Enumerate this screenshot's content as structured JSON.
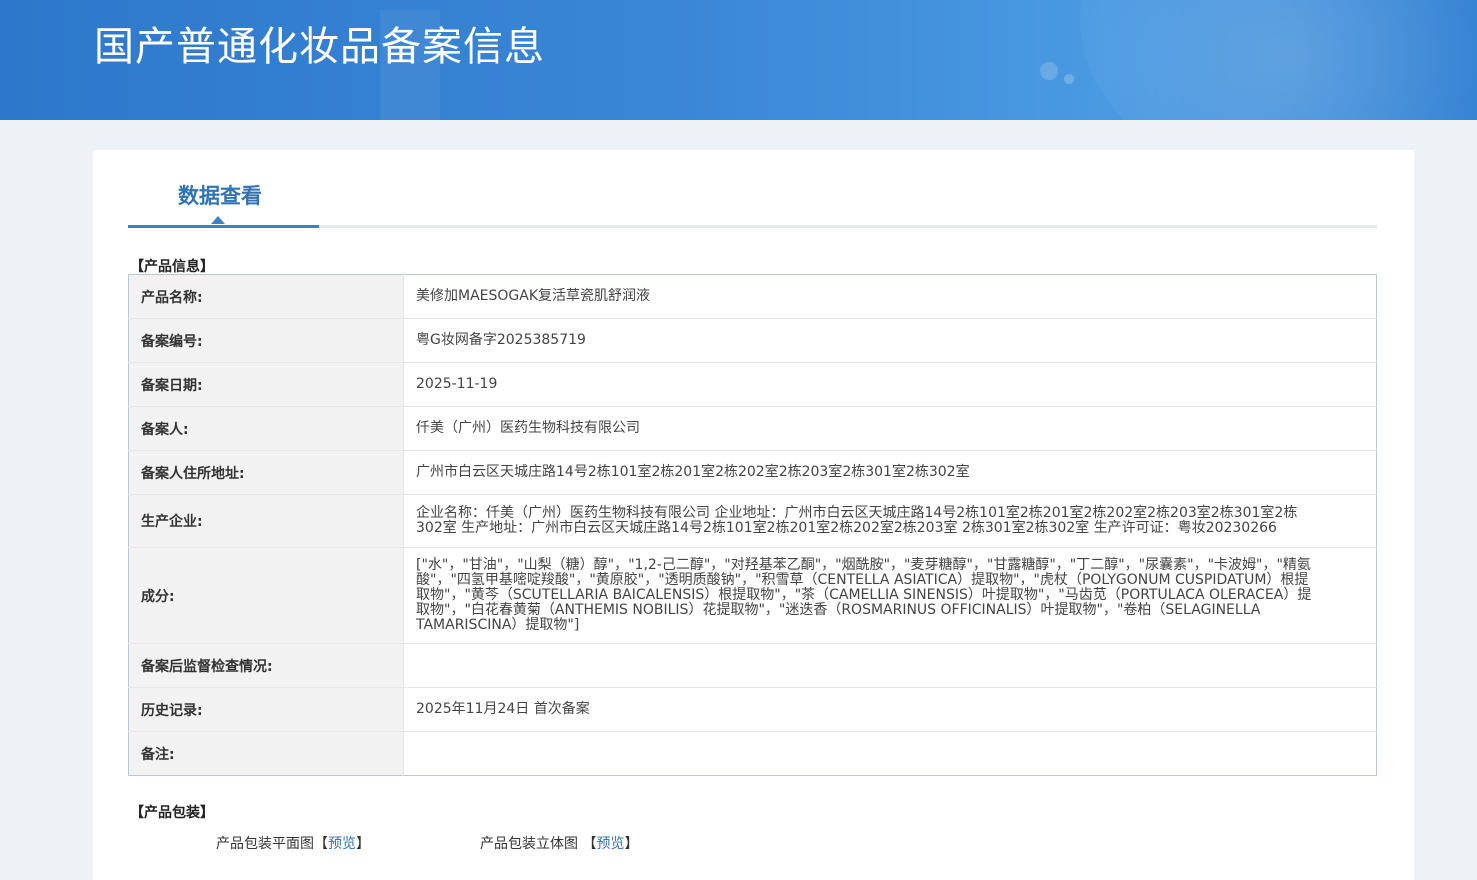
{
  "header": {
    "title": "国产普通化妆品备案信息"
  },
  "tabs": [
    {
      "label": "数据查看",
      "active": true
    }
  ],
  "product_info": {
    "section_title": "【产品信息】",
    "rows": [
      {
        "label": "产品名称:",
        "value": "美修加MAESOGAK复活草瓷肌舒润液"
      },
      {
        "label": "备案编号:",
        "value": "粤G妆网备字2025385719"
      },
      {
        "label": "备案日期:",
        "value": "2025-11-19"
      },
      {
        "label": "备案人:",
        "value": "仟美（广州）医药生物科技有限公司"
      },
      {
        "label": "备案人住所地址:",
        "value": "广州市白云区天城庄路14号2栋101室2栋201室2栋202室2栋203室2栋301室2栋302室"
      },
      {
        "label": "生产企业:",
        "value": "企业名称：仟美（广州）医药生物科技有限公司 企业地址：广州市白云区天城庄路14号2栋101室2栋201室2栋202室2栋203室2栋301室2栋302室 生产地址：广州市白云区天城庄路14号2栋101室2栋201室2栋202室2栋203室 2栋301室2栋302室 生产许可证：粤妆20230266"
      },
      {
        "label": "成分:",
        "value": "[\"水\"，\"甘油\"，\"山梨（糖）醇\"，\"1,2-己二醇\"，\"对羟基苯乙酮\"，\"烟酰胺\"，\"麦芽糖醇\"，\"甘露糖醇\"，\"丁二醇\"，\"尿囊素\"，\"卡波姆\"，\"精氨酸\"，\"四氢甲基嘧啶羧酸\"，\"黄原胶\"，\"透明质酸钠\"，\"积雪草（CENTELLA ASIATICA）提取物\"，\"虎杖（POLYGONUM CUSPIDATUM）根提取物\"，\"黄芩（SCUTELLARIA BAICALENSIS）根提取物\"，\"茶（CAMELLIA SINENSIS）叶提取物\"，\"马齿苋（PORTULACA OLERACEA）提取物\"，\"白花春黄菊（ANTHEMIS NOBILIS）花提取物\"，\"迷迭香（ROSMARINUS OFFICINALIS）叶提取物\"，\"卷柏（SELAGINELLA TAMARISCINA）提取物\"]"
      },
      {
        "label": "备案后监督检查情况:",
        "value": ""
      },
      {
        "label": "历史记录:",
        "value": "2025年11月24日 首次备案"
      },
      {
        "label": "备注:",
        "value": ""
      }
    ]
  },
  "product_packaging": {
    "section_title": "【产品包装】",
    "items": [
      {
        "label": "产品包装平面图",
        "link_open": "【",
        "link_text": "预览",
        "link_close": "】"
      },
      {
        "label": "产品包装立体图 ",
        "link_open": "【",
        "link_text": "预览",
        "link_close": "】"
      }
    ]
  },
  "colors": {
    "banner": "#3a86d6",
    "tab_active": "#3173b3",
    "link": "#2f74b8",
    "label_bg": "#f2f2f2"
  }
}
